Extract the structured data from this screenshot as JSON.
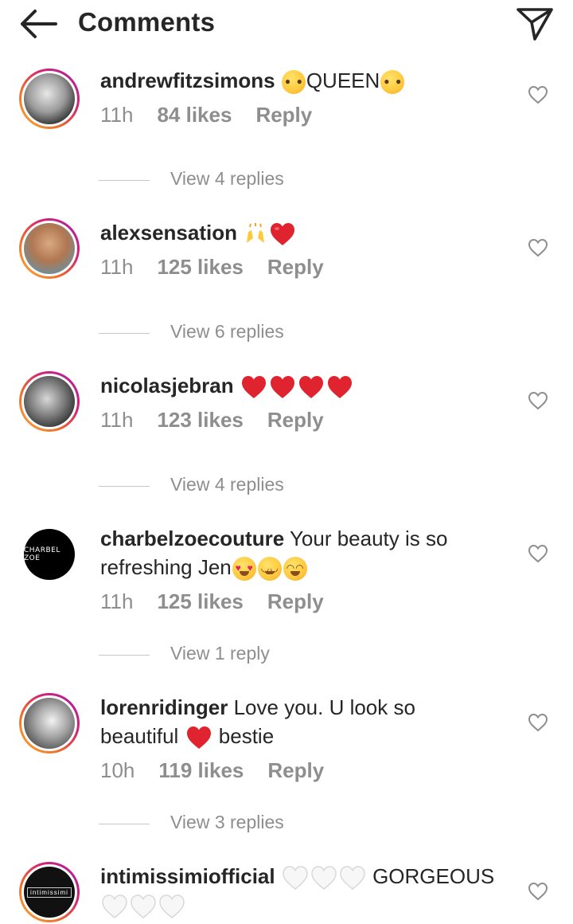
{
  "header": {
    "title": "Comments",
    "back_icon": "arrow-left-icon",
    "send_icon": "paper-plane-icon"
  },
  "colors": {
    "text": "#262626",
    "muted": "#8e8e8e",
    "heart_red": "#e0242f",
    "story_ring": [
      "#f9b234",
      "#d6246e",
      "#a21fb0"
    ]
  },
  "comments": [
    {
      "username": "andrewfitzsimons",
      "text": "QUEEN",
      "time": "11h",
      "likes": "84 likes",
      "reply": "Reply",
      "view_replies": "View 4 replies"
    },
    {
      "username": "alexsensation",
      "text": "",
      "time": "11h",
      "likes": "125 likes",
      "reply": "Reply",
      "view_replies": "View 6 replies"
    },
    {
      "username": "nicolasjebran",
      "text": "",
      "time": "11h",
      "likes": "123 likes",
      "reply": "Reply",
      "view_replies": "View 4 replies"
    },
    {
      "username": "charbelzoecouture",
      "text": "Your beauty is so refreshing Jen",
      "time": "11h",
      "likes": "125 likes",
      "reply": "Reply",
      "view_replies": "View 1 reply",
      "avatar_text": "CHARBEL ZOE"
    },
    {
      "username": "lorenridinger",
      "text_a": "Love you.  U look so beautiful",
      "text_b": "bestie",
      "time": "10h",
      "likes": "119 likes",
      "reply": "Reply",
      "view_replies": "View 3 replies"
    },
    {
      "username": "intimissimiofficial",
      "text": "GORGEOUS",
      "avatar_text": "intimissimi"
    }
  ]
}
